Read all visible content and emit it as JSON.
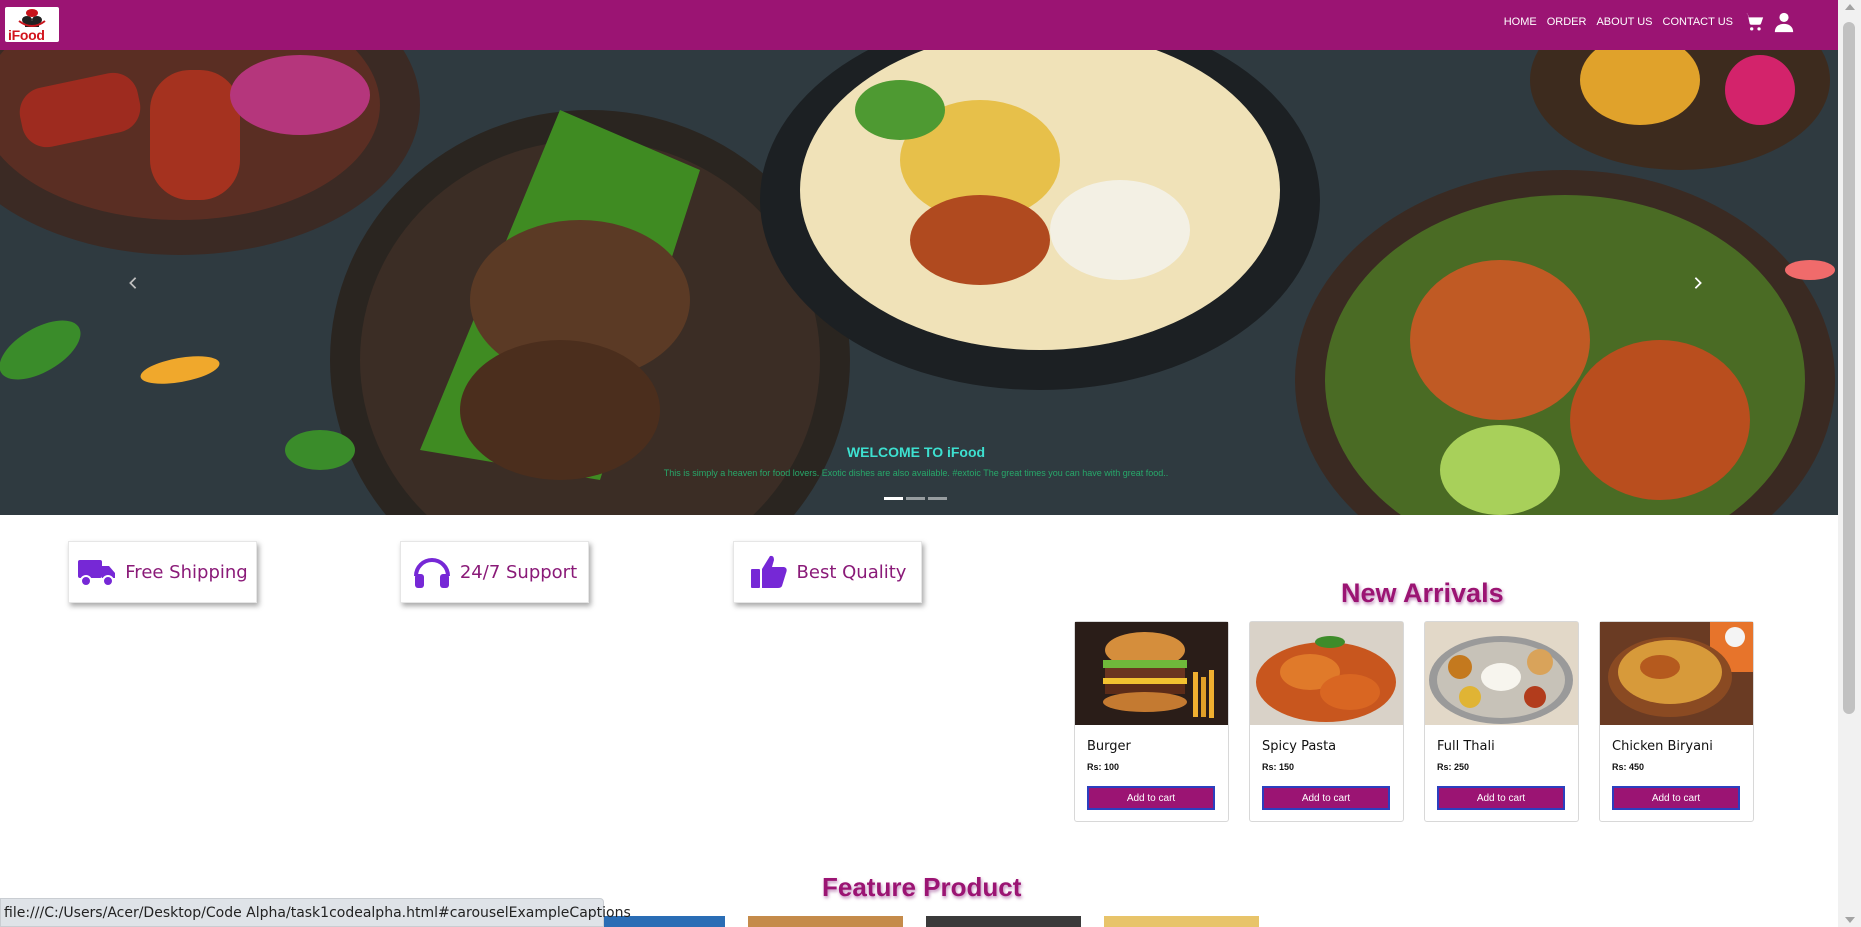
{
  "brand": {
    "logo_text": "iFood"
  },
  "nav": {
    "links": [
      "HOME",
      "ORDER",
      "ABOUT US",
      "CONTACT US"
    ],
    "cart_icon": "cart-icon",
    "user_icon": "user-icon"
  },
  "carousel": {
    "caption_title": "WELCOME TO iFood",
    "caption_text": "This is simply a heaven for food lovers. Exotic dishes are also available. #extoic The great times you can have with great food..",
    "slides": 3,
    "active_slide": 1
  },
  "features": [
    {
      "label": "Free Shipping",
      "icon": "truck-icon"
    },
    {
      "label": "24/7 Support",
      "icon": "headphones-icon"
    },
    {
      "label": "Best Quality",
      "icon": "thumbs-up-icon"
    }
  ],
  "new_arrivals": {
    "title": "New Arrivals",
    "items": [
      {
        "name": "Burger",
        "price": "Rs: 100",
        "button": "Add to cart"
      },
      {
        "name": "Spicy Pasta",
        "price": "Rs: 150",
        "button": "Add to cart"
      },
      {
        "name": "Full Thali",
        "price": "Rs: 250",
        "button": "Add to cart"
      },
      {
        "name": "Chicken Biryani",
        "price": "Rs: 450",
        "button": "Add to cart"
      }
    ]
  },
  "feature_product": {
    "title": "Feature Product"
  },
  "status_bar": {
    "url": "file:///C:/Users/Acer/Desktop/Code Alpha/task1codealpha.html#carouselExampleCaptions"
  },
  "colors": {
    "brand": "#9b1473",
    "accent": "#7628d6",
    "caption_title": "#3de0d0",
    "caption_text": "#27a86a"
  }
}
